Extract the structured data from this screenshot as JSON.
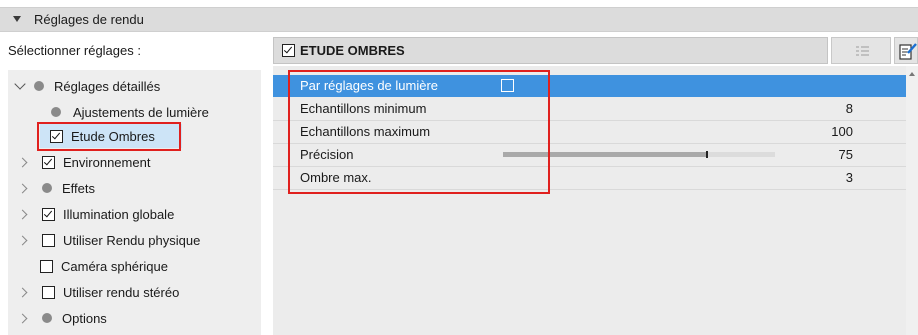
{
  "header": {
    "title": "Réglages de rendu",
    "expand_icon": "triangle-down-icon"
  },
  "selector": {
    "label": "Sélectionner réglages :"
  },
  "tree": {
    "items": [
      {
        "label": "Réglages détaillés",
        "indicator": "dot",
        "expander": "chevron-down",
        "level": 0
      },
      {
        "label": "Ajustements de lumière",
        "indicator": "dot",
        "expander": "none",
        "level": 1
      },
      {
        "label": "Etude Ombres",
        "indicator": "checkbox",
        "checked": true,
        "expander": "none",
        "level": 1,
        "selected": true
      },
      {
        "label": "Environnement",
        "indicator": "checkbox",
        "checked": true,
        "expander": "chevron-right",
        "level": 1
      },
      {
        "label": "Effets",
        "indicator": "dot",
        "expander": "chevron-right",
        "level": 1
      },
      {
        "label": "Illumination globale",
        "indicator": "checkbox",
        "checked": true,
        "expander": "chevron-right",
        "level": 1
      },
      {
        "label": "Utiliser Rendu physique",
        "indicator": "checkbox",
        "checked": false,
        "expander": "chevron-right",
        "level": 1
      },
      {
        "label": "Caméra sphérique",
        "indicator": "checkbox",
        "checked": false,
        "expander": "none",
        "level": 1
      },
      {
        "label": "Utiliser rendu stéréo",
        "indicator": "checkbox",
        "checked": false,
        "expander": "chevron-right",
        "level": 1
      },
      {
        "label": "Options",
        "indicator": "dot",
        "expander": "chevron-right",
        "level": 1
      }
    ]
  },
  "panel": {
    "title": "ETUDE OMBRES",
    "title_checked": true,
    "list_icon": "list-view-icon",
    "edit_icon": "edit-document-icon",
    "properties": [
      {
        "label": "Par réglages de lumière",
        "type": "checkbox",
        "checked": false
      },
      {
        "label": "Echantillons minimum",
        "type": "number",
        "value": "8"
      },
      {
        "label": "Echantillons maximum",
        "type": "number",
        "value": "100"
      },
      {
        "label": "Précision",
        "type": "slider",
        "value": "75",
        "slider_fraction": 0.75
      },
      {
        "label": "Ombre max.",
        "type": "number",
        "value": "3"
      }
    ]
  },
  "colors": {
    "accent": "#3f92df",
    "selection": "#cde4f7",
    "annotation": "#e0201e"
  }
}
